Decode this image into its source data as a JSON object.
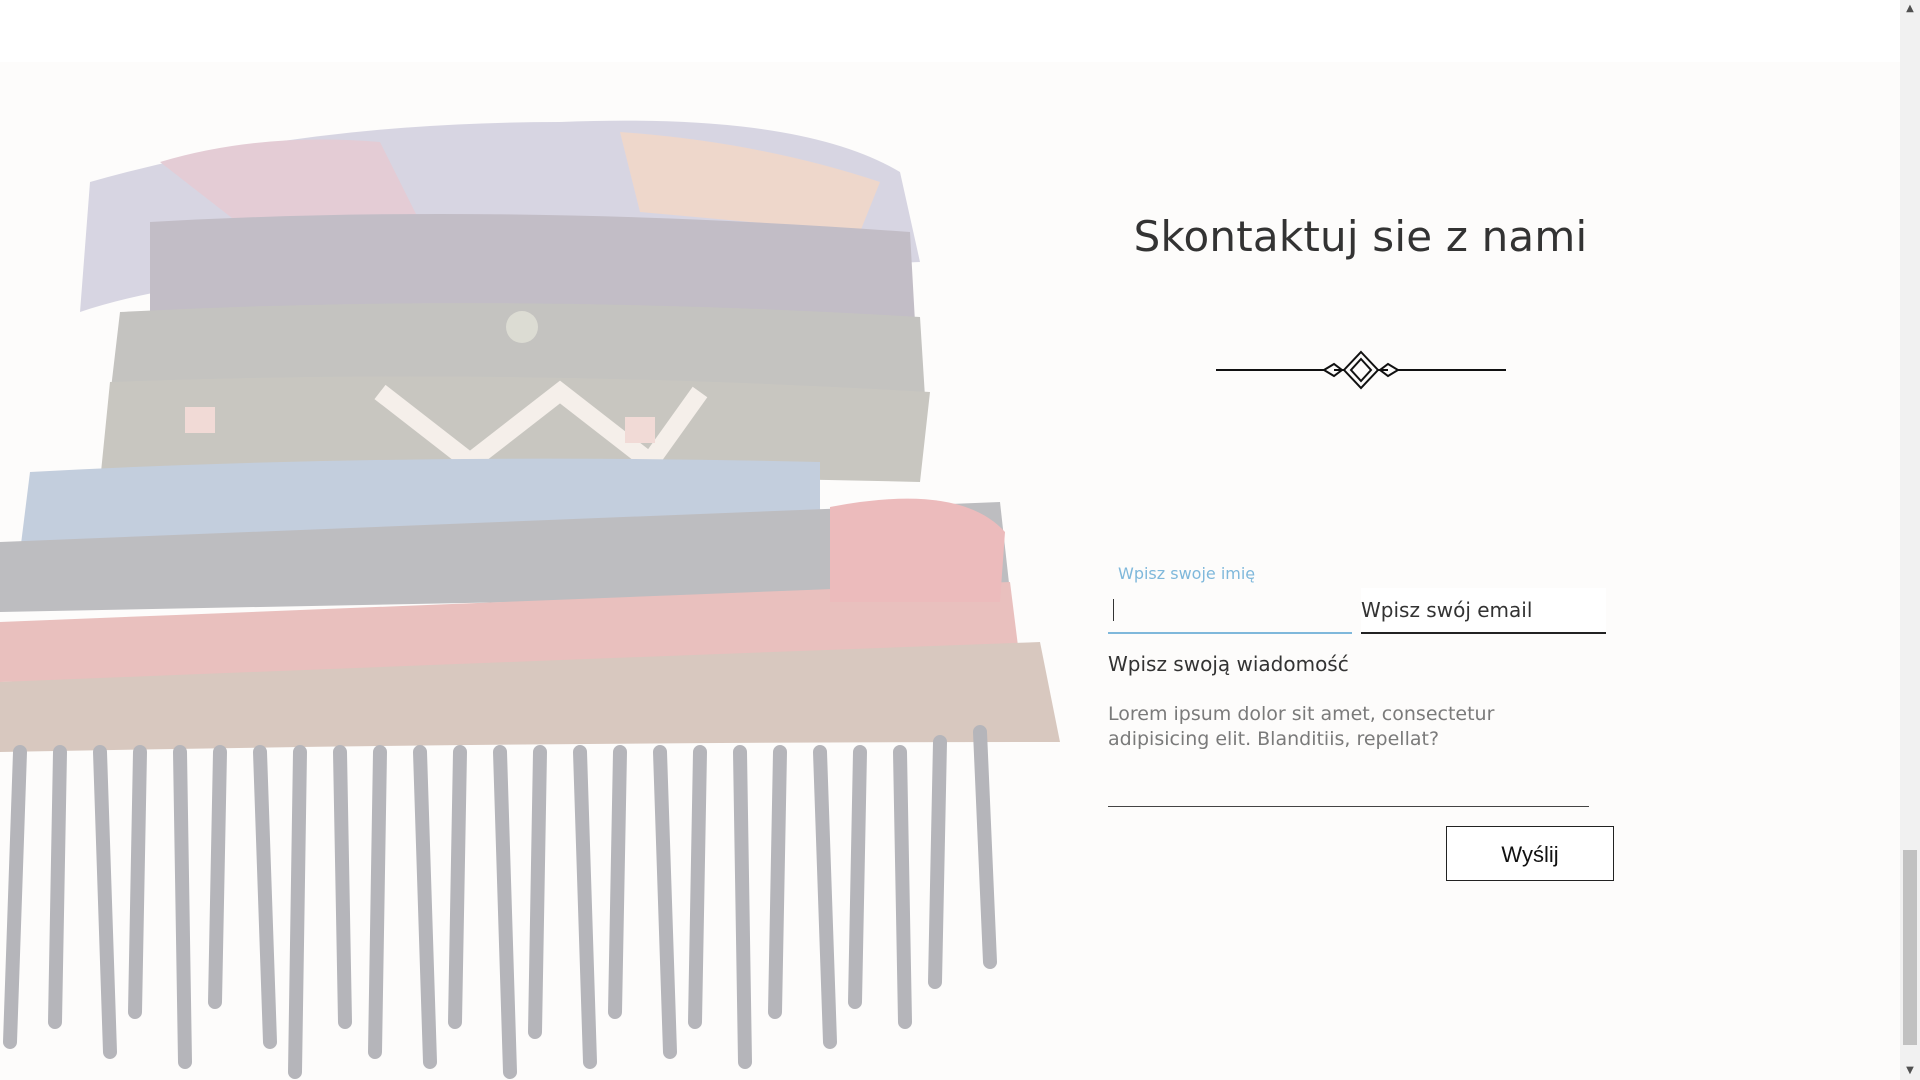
{
  "contact": {
    "title": "Skontaktuj sie z nami",
    "name_label": "Wpisz swoje imię",
    "name_value": "",
    "email_placeholder": "Wpisz swój email",
    "message_label": "Wpisz swoją wiadomość",
    "message_placeholder": "Lorem ipsum dolor sit amet, consectetur adipisicing elit. Blanditiis, repellat?",
    "send_label": "Wyślij"
  },
  "colors": {
    "accent_focus": "#7fb8db",
    "text": "#333333",
    "border": "#222222"
  },
  "icons": {
    "ornament": "ornamental-divider-icon",
    "scroll_up": "scroll-up-arrow-icon",
    "scroll_down": "scroll-down-arrow-icon"
  }
}
